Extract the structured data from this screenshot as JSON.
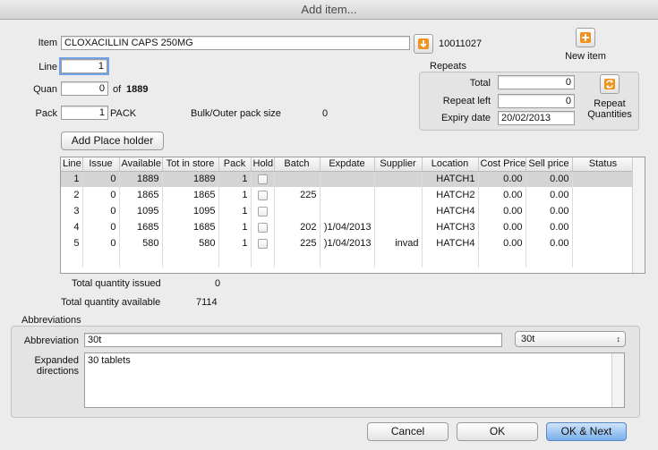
{
  "window": {
    "title": "Add item..."
  },
  "item": {
    "label": "Item",
    "value": "CLOXACILLIN CAPS 250MG",
    "code": "10011027"
  },
  "line": {
    "label": "Line",
    "value": "1"
  },
  "quan": {
    "label": "Quan",
    "value": "0",
    "of_text": "of",
    "available": "1889"
  },
  "pack": {
    "label": "Pack",
    "value": "1",
    "unit": "PACK"
  },
  "bulk": {
    "label": "Bulk/Outer pack size",
    "value": "0"
  },
  "new_item": {
    "label": "New item"
  },
  "repeats": {
    "title": "Repeats",
    "total_label": "Total",
    "total_value": "0",
    "repeat_left_label": "Repeat left",
    "repeat_left_value": "0",
    "expiry_label": "Expiry date",
    "expiry_value": "20/02/2013",
    "repeat_quantities_label_1": "Repeat",
    "repeat_quantities_label_2": "Quantities"
  },
  "add_place_holder": "Add Place holder",
  "table": {
    "headers": [
      "Line",
      "Issue",
      "Available",
      "Tot in store",
      "Pack",
      "Hold",
      "Batch",
      "Expdate",
      "Supplier",
      "Location",
      "Cost Price",
      "Sell price",
      "Status"
    ],
    "rows": [
      {
        "line": "1",
        "issue": "0",
        "available": "1889",
        "tot": "1889",
        "pack": "1",
        "batch": "",
        "expdate": "",
        "supplier": "",
        "location": "HATCH1",
        "cost": "0.00",
        "sell": "0.00",
        "status": ""
      },
      {
        "line": "2",
        "issue": "0",
        "available": "1865",
        "tot": "1865",
        "pack": "1",
        "batch": "225",
        "expdate": "",
        "supplier": "",
        "location": "HATCH2",
        "cost": "0.00",
        "sell": "0.00",
        "status": ""
      },
      {
        "line": "3",
        "issue": "0",
        "available": "1095",
        "tot": "1095",
        "pack": "1",
        "batch": "",
        "expdate": "",
        "supplier": "",
        "location": "HATCH4",
        "cost": "0.00",
        "sell": "0.00",
        "status": ""
      },
      {
        "line": "4",
        "issue": "0",
        "available": "1685",
        "tot": "1685",
        "pack": "1",
        "batch": "202",
        "expdate": ")1/04/2013",
        "supplier": "",
        "location": "HATCH3",
        "cost": "0.00",
        "sell": "0.00",
        "status": ""
      },
      {
        "line": "5",
        "issue": "0",
        "available": "580",
        "tot": "580",
        "pack": "1",
        "batch": "225",
        "expdate": ")1/04/2013",
        "supplier": "invad",
        "location": "HATCH4",
        "cost": "0.00",
        "sell": "0.00",
        "status": ""
      }
    ]
  },
  "totals": {
    "issued_label": "Total quantity issued",
    "issued_value": "0",
    "available_label": "Total quantity available",
    "available_value": "7114"
  },
  "abbreviations": {
    "title": "Abbreviations",
    "abbrev_label": "Abbreviation",
    "abbrev_value": "30t",
    "select_value": "30t",
    "expanded_label_1": "Expanded",
    "expanded_label_2": "directions",
    "expanded_value": "30 tablets"
  },
  "buttons": {
    "cancel": "Cancel",
    "ok": "OK",
    "ok_next": "OK & Next"
  },
  "colors": {
    "accent": "#79aeea",
    "add_icon": "#f0921e"
  }
}
